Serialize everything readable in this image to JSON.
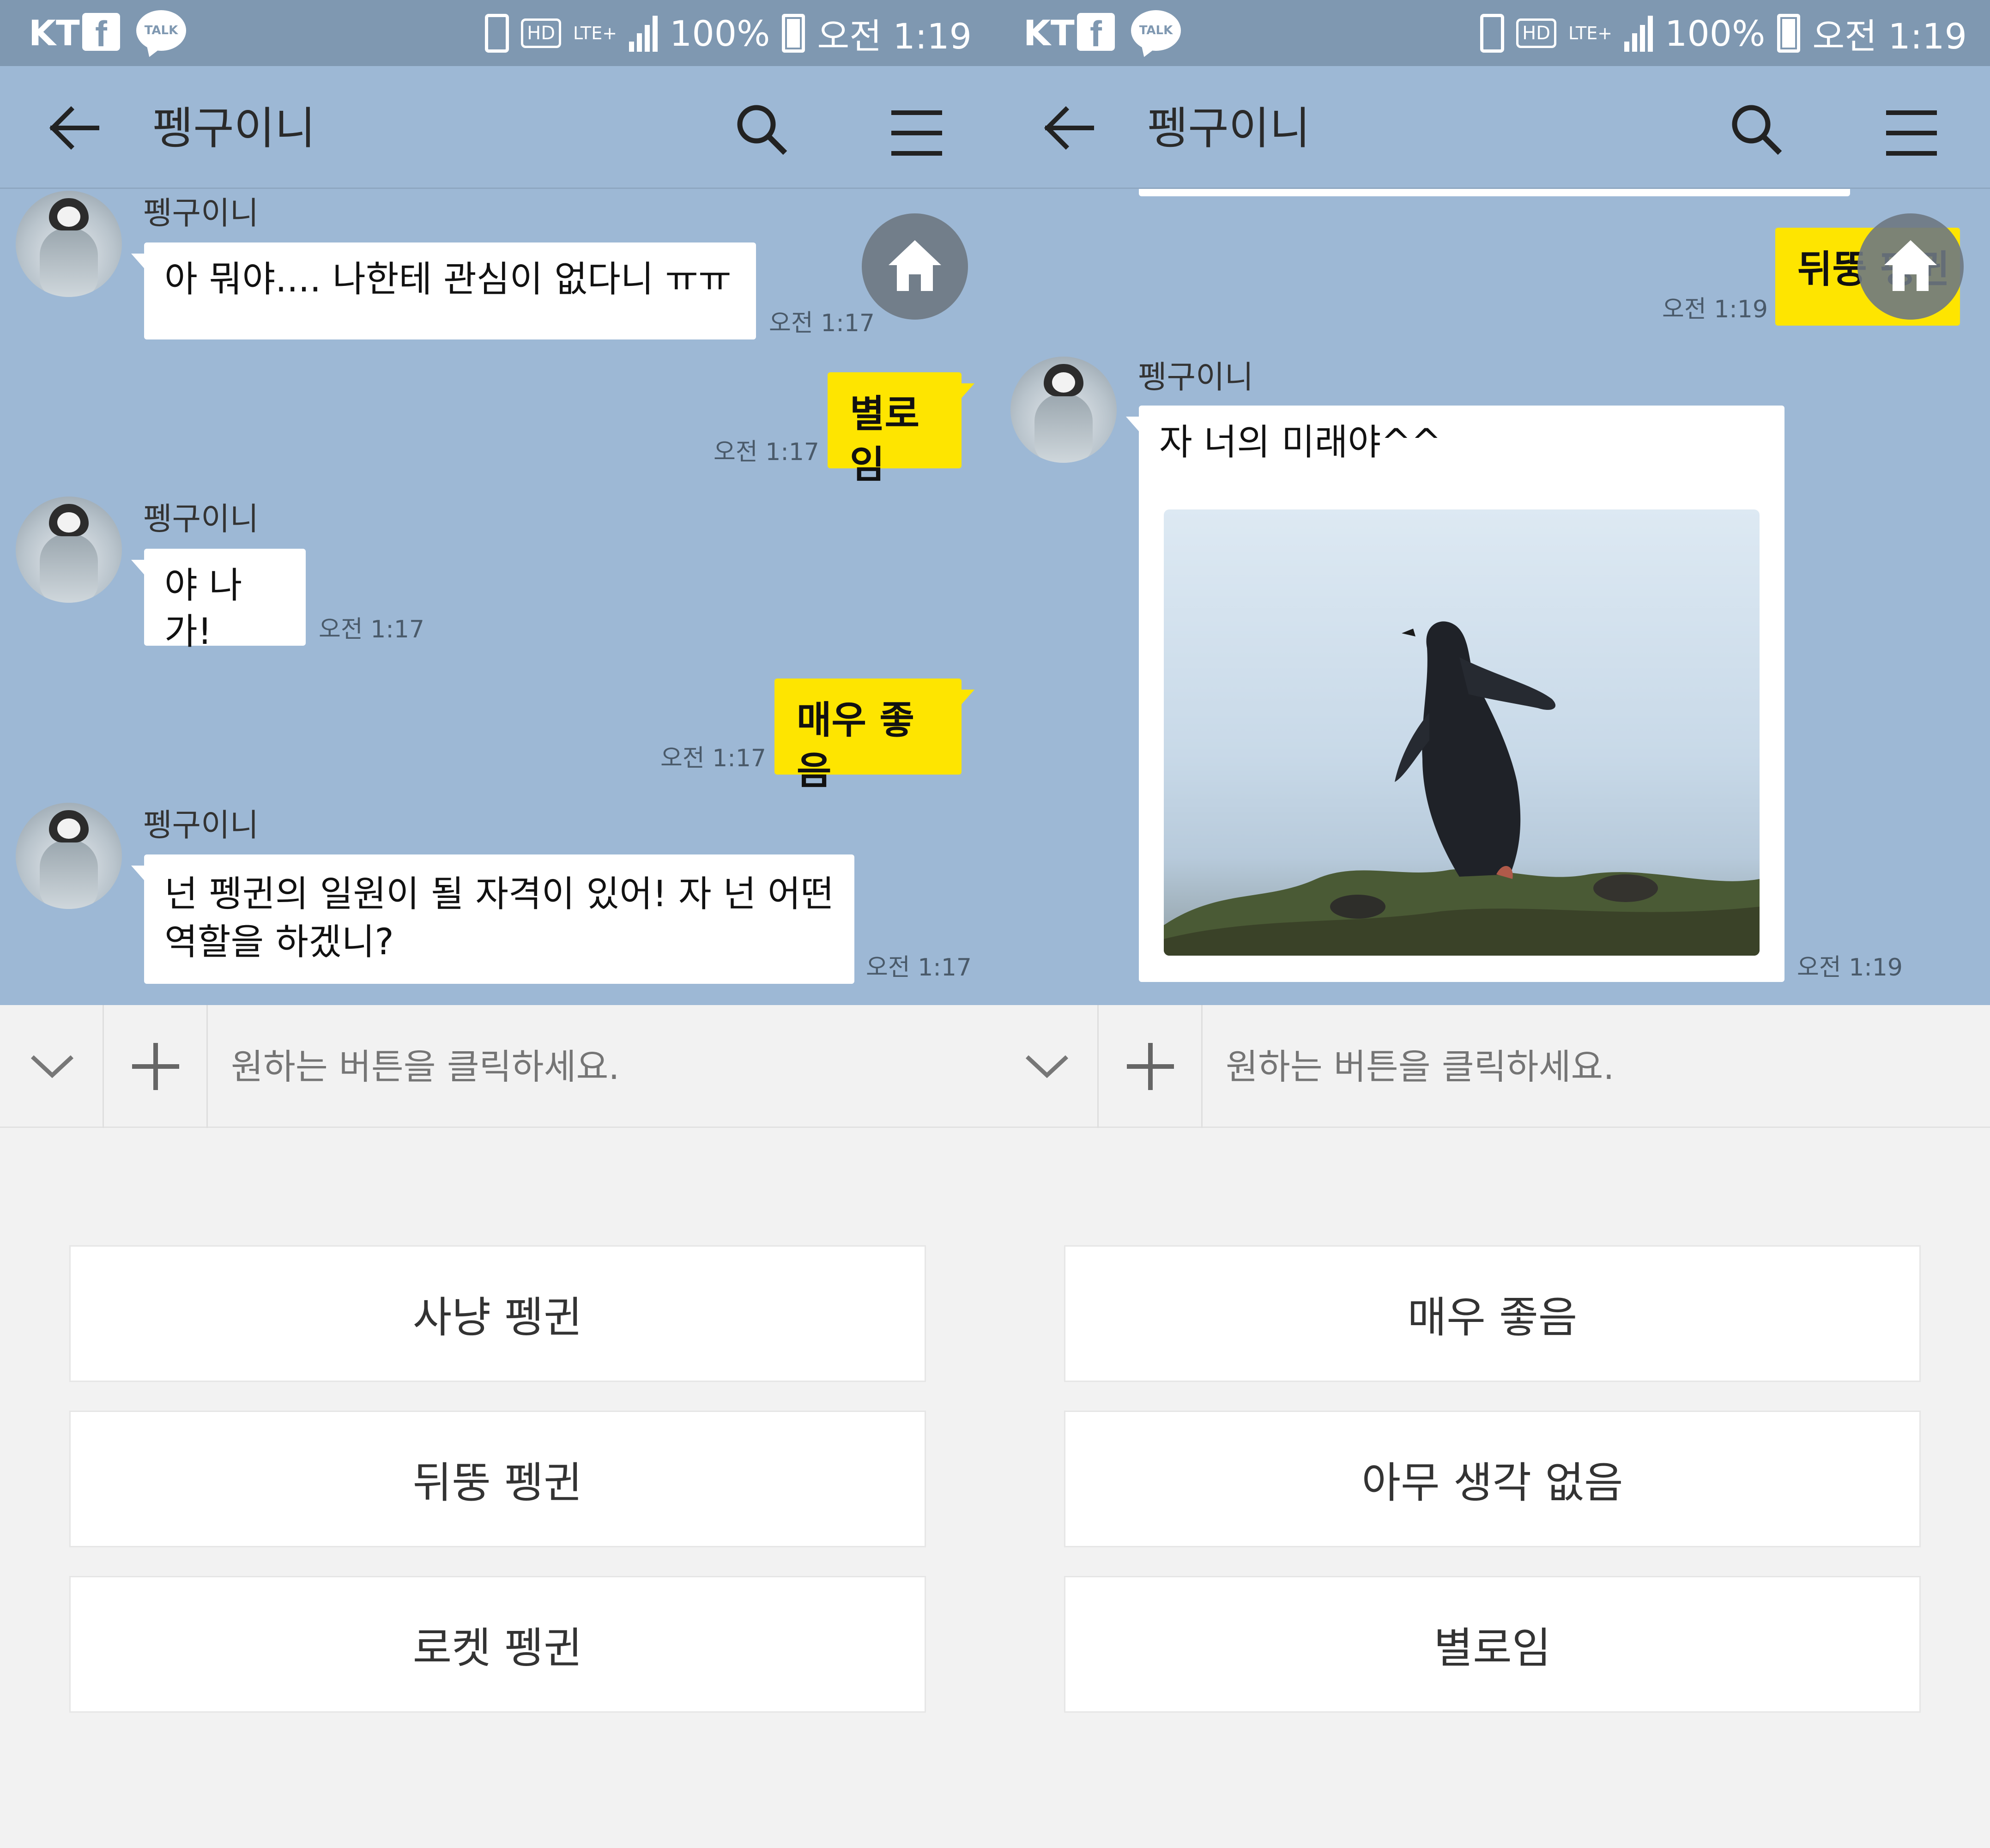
{
  "status_bar": {
    "carrier": "KT",
    "facebook_icon": "f",
    "talk_icon": "TALK",
    "hd": "HD",
    "network": "LTE+",
    "battery": "100%",
    "time": "오전 1:19"
  },
  "header": {
    "title": "펭구이니"
  },
  "left": {
    "messages": [
      {
        "sender": "펭구이니",
        "text": "아 뭐야.... 나한테 관심이 없다니 ㅠㅠ",
        "time": "오전 1:17"
      },
      {
        "text": "별로임",
        "time": "오전 1:17"
      },
      {
        "sender": "펭구이니",
        "text": "야 나가!",
        "time": "오전 1:17"
      },
      {
        "text": "매우 좋음",
        "time": "오전 1:17"
      },
      {
        "sender": "펭구이니",
        "text_line1": "넌 펭귄의 일원이 될 자격이 있어! 자 넌 어떤",
        "text_line2": "역할을 하겠니?",
        "time": "오전 1:17"
      }
    ],
    "quick_replies": [
      "사냥 펭귄",
      "뒤뚱 펭귄",
      "로켓 펭귄"
    ]
  },
  "right": {
    "messages": [
      {
        "text": "뒤뚱 펭귄",
        "time": "오전 1:19"
      },
      {
        "sender": "펭구이니",
        "text": "자 너의 미래야^^",
        "time": "오전 1:19"
      }
    ],
    "quick_replies": [
      "매우 좋음",
      "아무 생각 없음",
      "별로임"
    ]
  },
  "input": {
    "placeholder": "원하는 버튼을 클릭하세요."
  },
  "colors": {
    "chat_background": "#9db8d5",
    "status_bar": "#7f98b1",
    "bubble_out": "#fee500",
    "bubble_in": "#ffffff"
  },
  "icons": [
    "back-arrow-icon",
    "search-icon",
    "menu-icon",
    "home-icon",
    "chevron-down-icon",
    "plus-icon"
  ]
}
